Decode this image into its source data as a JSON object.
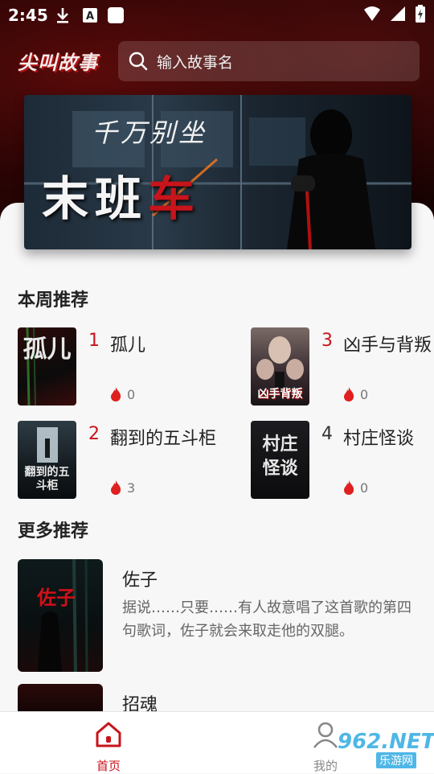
{
  "status_bar": {
    "time": "2:45"
  },
  "header": {
    "logo": "尖叫故事",
    "search_placeholder": "输入故事名"
  },
  "banner": {
    "subtitle": "千万别坐",
    "title_main": "末班",
    "title_blood": "车"
  },
  "weekly": {
    "title": "本周推荐",
    "items": [
      {
        "rank": "1",
        "title": "孤儿",
        "heat": "0",
        "cover_text": "孤儿"
      },
      {
        "rank": "3",
        "title": "凶手与背叛",
        "heat": "0",
        "cover_text": "凶手背叛"
      },
      {
        "rank": "2",
        "title": "翻到的五斗柜",
        "heat": "3",
        "cover_text": "翻到的五斗柜"
      },
      {
        "rank": "4",
        "title": "村庄怪谈",
        "heat": "0",
        "cover_text": "村庄怪谈"
      }
    ]
  },
  "more": {
    "title": "更多推荐",
    "items": [
      {
        "title": "佐子",
        "desc": "据说……只要……有人故意唱了这首歌的第四句歌词，佐子就会来取走他的双腿。",
        "cover_text": "佐子"
      },
      {
        "title": "招魂",
        "desc": ""
      }
    ]
  },
  "nav": {
    "home": "首页",
    "mine": "我的"
  },
  "watermark": {
    "main": "962.NET",
    "sub": "乐游网"
  },
  "colors": {
    "accent": "#c8141b",
    "header_dark": "#2a0404"
  }
}
